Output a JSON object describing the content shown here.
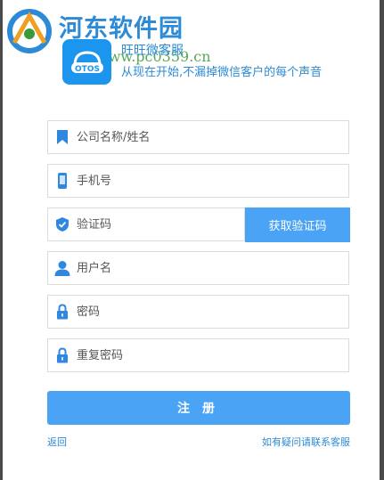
{
  "watermark": {
    "site_name": "河东软件园",
    "url": "www.pc0359.cn"
  },
  "app": {
    "icon_text": "OTOS",
    "name": "旺旺微客服",
    "slogan": "从现在开始,不漏掉微信客户的每个声音"
  },
  "form": {
    "company_placeholder": "公司名称/姓名",
    "phone_placeholder": "手机号",
    "code_placeholder": "验证码",
    "get_code_label": "获取验证码",
    "username_placeholder": "用户名",
    "password_placeholder": "密码",
    "confirm_password_placeholder": "重复密码",
    "submit_label": "注册"
  },
  "links": {
    "back": "返回",
    "support": "如有疑问请联系客服"
  },
  "colors": {
    "accent": "#4aa3f5",
    "link": "#2c8ad6",
    "app_icon": "#1b95ee"
  }
}
